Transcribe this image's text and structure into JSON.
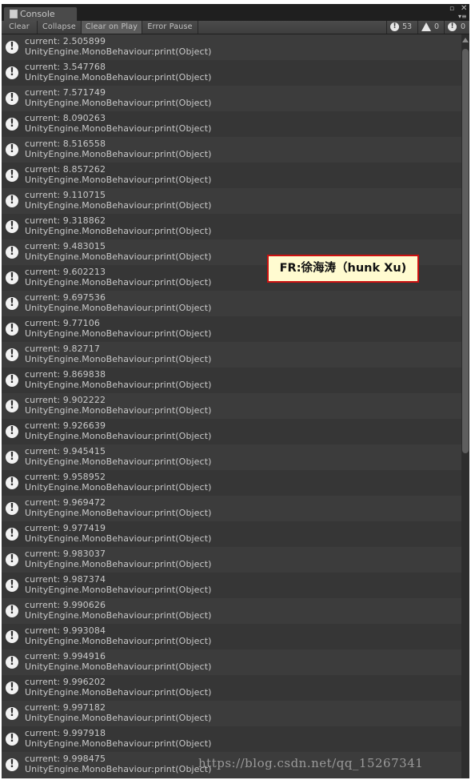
{
  "window": {
    "tab_title": "Console"
  },
  "toolbar": {
    "buttons": [
      "Clear",
      "Collapse",
      "Clear on Play",
      "Error Pause"
    ],
    "active_button": "Clear on Play",
    "counts": {
      "info": "53",
      "warning": "0",
      "error": "0"
    }
  },
  "log_entries": [
    {
      "line1": "current: 2.505899",
      "line2": "UnityEngine.MonoBehaviour:print(Object)"
    },
    {
      "line1": "current: 3.547768",
      "line2": "UnityEngine.MonoBehaviour:print(Object)"
    },
    {
      "line1": "current: 7.571749",
      "line2": "UnityEngine.MonoBehaviour:print(Object)"
    },
    {
      "line1": "current: 8.090263",
      "line2": "UnityEngine.MonoBehaviour:print(Object)"
    },
    {
      "line1": "current: 8.516558",
      "line2": "UnityEngine.MonoBehaviour:print(Object)"
    },
    {
      "line1": "current: 8.857262",
      "line2": "UnityEngine.MonoBehaviour:print(Object)"
    },
    {
      "line1": "current: 9.110715",
      "line2": "UnityEngine.MonoBehaviour:print(Object)"
    },
    {
      "line1": "current: 9.318862",
      "line2": "UnityEngine.MonoBehaviour:print(Object)"
    },
    {
      "line1": "current: 9.483015",
      "line2": "UnityEngine.MonoBehaviour:print(Object)"
    },
    {
      "line1": "current: 9.602213",
      "line2": "UnityEngine.MonoBehaviour:print(Object)"
    },
    {
      "line1": "current: 9.697536",
      "line2": "UnityEngine.MonoBehaviour:print(Object)"
    },
    {
      "line1": "current: 9.77106",
      "line2": "UnityEngine.MonoBehaviour:print(Object)"
    },
    {
      "line1": "current: 9.82717",
      "line2": "UnityEngine.MonoBehaviour:print(Object)"
    },
    {
      "line1": "current: 9.869838",
      "line2": "UnityEngine.MonoBehaviour:print(Object)"
    },
    {
      "line1": "current: 9.902222",
      "line2": "UnityEngine.MonoBehaviour:print(Object)"
    },
    {
      "line1": "current: 9.926639",
      "line2": "UnityEngine.MonoBehaviour:print(Object)"
    },
    {
      "line1": "current: 9.945415",
      "line2": "UnityEngine.MonoBehaviour:print(Object)"
    },
    {
      "line1": "current: 9.958952",
      "line2": "UnityEngine.MonoBehaviour:print(Object)"
    },
    {
      "line1": "current: 9.969472",
      "line2": "UnityEngine.MonoBehaviour:print(Object)"
    },
    {
      "line1": "current: 9.977419",
      "line2": "UnityEngine.MonoBehaviour:print(Object)"
    },
    {
      "line1": "current: 9.983037",
      "line2": "UnityEngine.MonoBehaviour:print(Object)"
    },
    {
      "line1": "current: 9.987374",
      "line2": "UnityEngine.MonoBehaviour:print(Object)"
    },
    {
      "line1": "current: 9.990626",
      "line2": "UnityEngine.MonoBehaviour:print(Object)"
    },
    {
      "line1": "current: 9.993084",
      "line2": "UnityEngine.MonoBehaviour:print(Object)"
    },
    {
      "line1": "current: 9.994916",
      "line2": "UnityEngine.MonoBehaviour:print(Object)"
    },
    {
      "line1": "current: 9.996202",
      "line2": "UnityEngine.MonoBehaviour:print(Object)"
    },
    {
      "line1": "current: 9.997182",
      "line2": "UnityEngine.MonoBehaviour:print(Object)"
    },
    {
      "line1": "current: 9.997918",
      "line2": "UnityEngine.MonoBehaviour:print(Object)"
    },
    {
      "line1": "current: 9.998475",
      "line2": "UnityEngine.MonoBehaviour:print(Object)"
    }
  ],
  "watermark_text": "FR:徐海涛（hunk Xu)",
  "url_text": "https://blog.csdn.net/qq_15267341",
  "colors": {
    "background": "#383838",
    "row_alt": "#3c3c3c",
    "text": "#c9c9c9",
    "watermark_border": "#cc1111",
    "watermark_bg": "#fffbd0"
  }
}
